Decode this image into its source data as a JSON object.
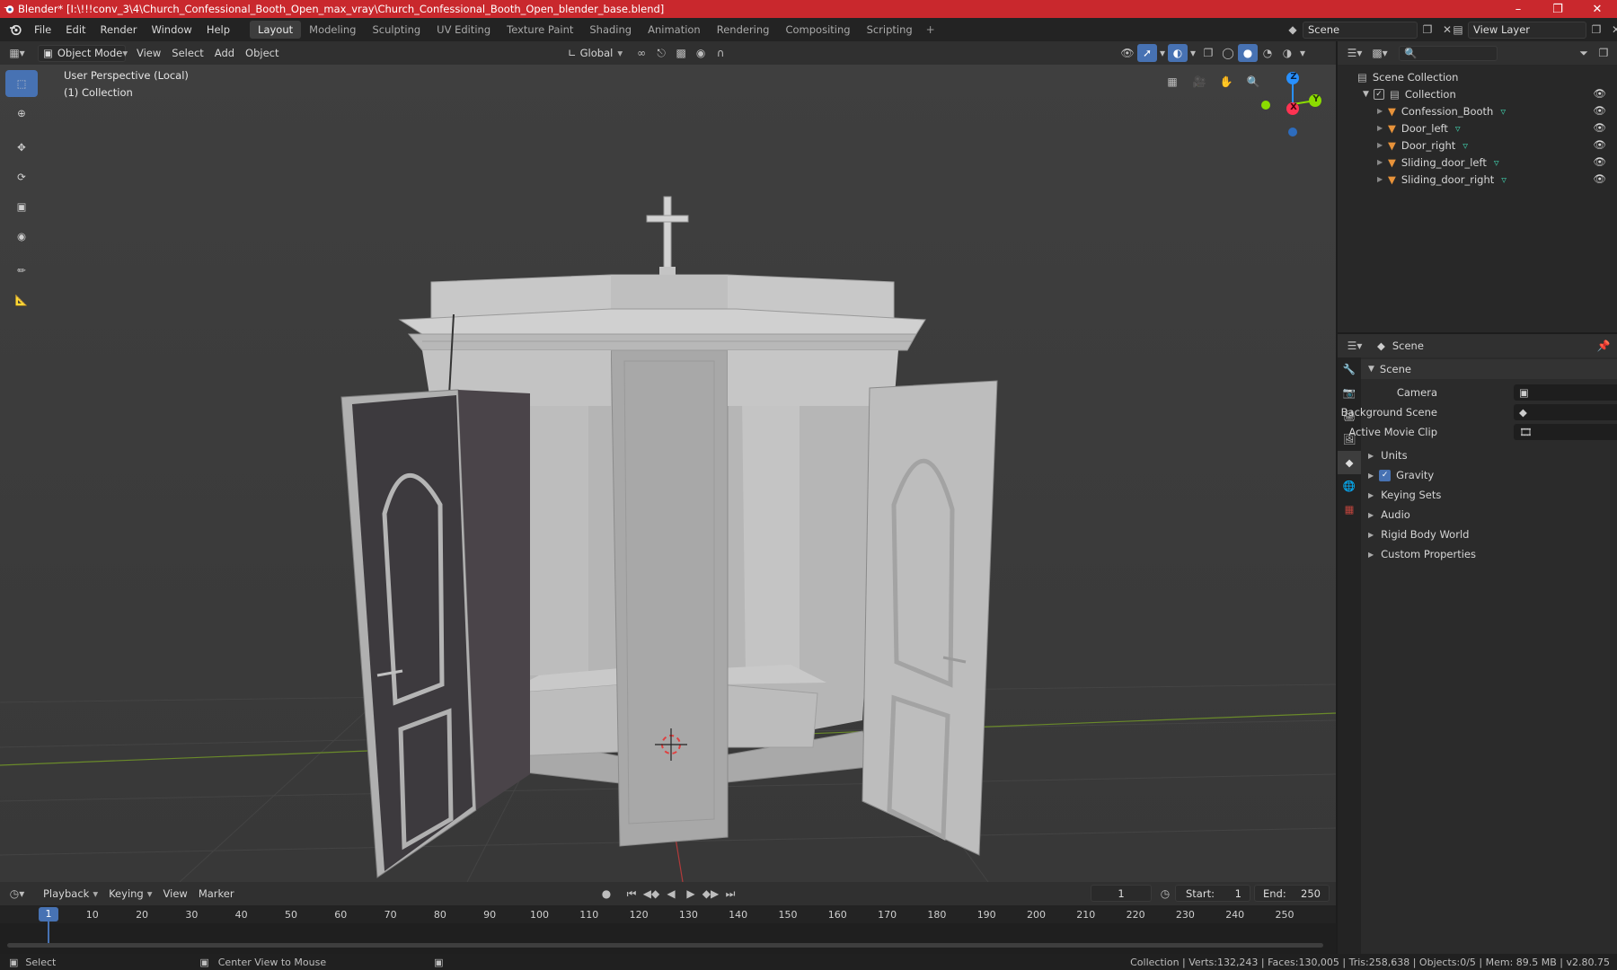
{
  "window": {
    "title": "Blender* [I:\\!!!conv_3\\4\\Church_Confessional_Booth_Open_max_vray\\Church_Confessional_Booth_Open_blender_base.blend]",
    "minimize_icon": "minimize-icon",
    "maximize_icon": "maximize-icon",
    "close_icon": "close-icon"
  },
  "menu": {
    "items": [
      "File",
      "Edit",
      "Render",
      "Window",
      "Help"
    ]
  },
  "workspaces": {
    "tabs": [
      "Layout",
      "Modeling",
      "Sculpting",
      "UV Editing",
      "Texture Paint",
      "Shading",
      "Animation",
      "Rendering",
      "Compositing",
      "Scripting"
    ],
    "active": "Layout"
  },
  "scene_selector": {
    "value": "Scene"
  },
  "view_layer_selector": {
    "value": "View Layer"
  },
  "viewport_header": {
    "mode": "Object Mode",
    "menus": [
      "View",
      "Select",
      "Add",
      "Object"
    ],
    "transform_orientation": "Global"
  },
  "viewport": {
    "perspective_label": "User Perspective (Local)",
    "collection_label": "(1) Collection",
    "gizmo_axes": {
      "z": "Z",
      "x": "X",
      "y": "Y"
    },
    "colors": {
      "axis_x": "#ff3352",
      "axis_y": "#8bdc00",
      "axis_z": "#2890ff",
      "grid_x_line": "#b03a3a",
      "grid_y_line": "#6a8a2a"
    }
  },
  "outliner": {
    "root": "Scene Collection",
    "collection": "Collection",
    "objects": [
      "Confession_Booth",
      "Door_left",
      "Door_right",
      "Sliding_door_left",
      "Sliding_door_right"
    ]
  },
  "properties": {
    "header_title": "Scene",
    "panel_title": "Scene",
    "fields": {
      "camera_label": "Camera",
      "background_scene_label": "Background Scene",
      "active_movie_clip_label": "Active Movie Clip"
    },
    "sections": [
      "Units",
      "Gravity",
      "Keying Sets",
      "Audio",
      "Rigid Body World",
      "Custom Properties"
    ],
    "gravity_checked": true
  },
  "timeline": {
    "menus": [
      "Playback",
      "Keying",
      "View",
      "Marker"
    ],
    "current_frame": "1",
    "start_label": "Start:",
    "start_value": "1",
    "end_label": "End:",
    "end_value": "250",
    "ticks": [
      "1",
      "10",
      "20",
      "30",
      "40",
      "50",
      "60",
      "70",
      "80",
      "90",
      "100",
      "110",
      "120",
      "130",
      "140",
      "150",
      "160",
      "170",
      "180",
      "190",
      "200",
      "210",
      "220",
      "230",
      "240",
      "250"
    ]
  },
  "statusbar": {
    "select_label": "Select",
    "center_label": "Center View to Mouse",
    "stats": "Collection | Verts:132,243 | Faces:130,005 | Tris:258,638 | Objects:0/5 | Mem: 89.5 MB | v2.80.75"
  }
}
